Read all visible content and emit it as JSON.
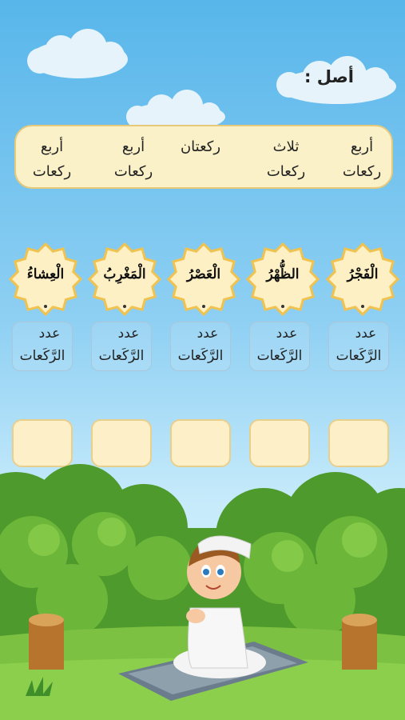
{
  "title": "أصل :",
  "options": [
    {
      "text": "أربع\nركعات"
    },
    {
      "text": "ثلاث\nركعات"
    },
    {
      "text": "ركعتان"
    },
    {
      "text": "أربع\nركعات"
    },
    {
      "text": "أربع\nركعات"
    }
  ],
  "prayers": [
    {
      "name": "الْفَجْرُ",
      "count_label": "عدد الرَّكَعات"
    },
    {
      "name": "الظُّهْرُ",
      "count_label": "عدد الرَّكَعات"
    },
    {
      "name": "الْعَصْرُ",
      "count_label": "عدد الرَّكَعات"
    },
    {
      "name": "الْمَغْرِبُ",
      "count_label": "عدد الرَّكَعات"
    },
    {
      "name": "الْعِشاءُ",
      "count_label": "عدد الرَّكَعات"
    }
  ],
  "count_line1": "عدد",
  "count_line2": "الرَّكَعات",
  "colors": {
    "sky": "#58b6ea",
    "panel": "#fbf1c8",
    "grass": "#7cc142",
    "bush": "#4f9a2c"
  },
  "illustration": "boy-praying-on-mat-icon"
}
